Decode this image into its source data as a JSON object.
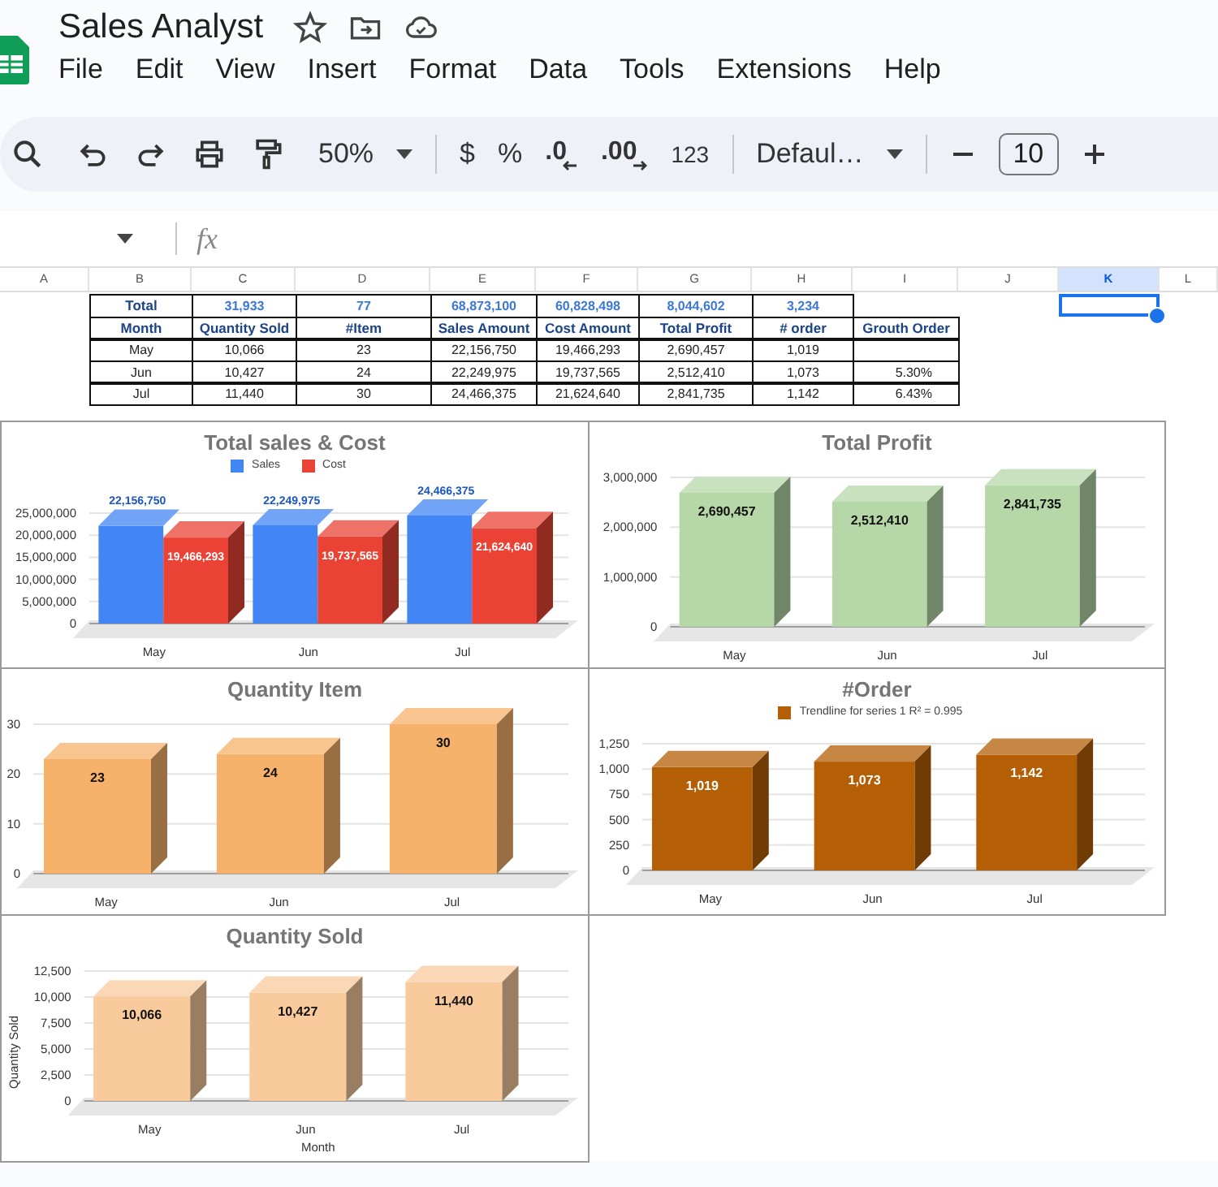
{
  "document": {
    "title": "Sales Analyst"
  },
  "menu": [
    "File",
    "Edit",
    "View",
    "Insert",
    "Format",
    "Data",
    "Tools",
    "Extensions",
    "Help"
  ],
  "toolbar": {
    "zoom": "50%",
    "currency": "$",
    "percent": "%",
    "decimals_less": ".0",
    "decimals_more": ".00",
    "number_format": "123",
    "font": "Defaul…",
    "font_size": "10"
  },
  "formula_bar": {
    "label": "fx"
  },
  "sheet": {
    "columns": [
      {
        "label": "A",
        "selected": false
      },
      {
        "label": "B",
        "selected": false
      },
      {
        "label": "C",
        "selected": false
      },
      {
        "label": "D",
        "selected": false
      },
      {
        "label": "E",
        "selected": false
      },
      {
        "label": "F",
        "selected": false
      },
      {
        "label": "G",
        "selected": false
      },
      {
        "label": "H",
        "selected": false
      },
      {
        "label": "I",
        "selected": false
      },
      {
        "label": "J",
        "selected": false
      },
      {
        "label": "K",
        "selected": true
      },
      {
        "label": "L",
        "selected": false
      }
    ],
    "rows": [
      {
        "kind": "total",
        "cells": [
          "",
          "Total",
          "31,933",
          "77",
          "68,873,100",
          "60,828,498",
          "8,044,602",
          "3,234"
        ]
      },
      {
        "kind": "header",
        "cells": [
          "",
          "Month",
          "Quantity  Sold",
          "#Item",
          "Sales Amount",
          "Cost Amount",
          "Total Profit",
          "# order",
          "Grouth Order"
        ]
      },
      {
        "kind": "data",
        "cells": [
          "",
          "May",
          "10,066",
          "23",
          "22,156,750",
          "19,466,293",
          "2,690,457",
          "1,019",
          ""
        ]
      },
      {
        "kind": "data",
        "cells": [
          "",
          "Jun",
          "10,427",
          "24",
          "22,249,975",
          "19,737,565",
          "2,512,410",
          "1,073",
          "5.30%"
        ]
      },
      {
        "kind": "data",
        "cells": [
          "",
          "Jul",
          "11,440",
          "30",
          "24,466,375",
          "21,624,640",
          "2,841,735",
          "1,142",
          "6.43%"
        ]
      }
    ]
  },
  "charts": [
    {
      "show_legend": true,
      "chart_data": {
        "type": "bar",
        "title": "Total sales & Cost",
        "categories": [
          "May",
          "Jun",
          "Jul"
        ],
        "series": [
          {
            "name": "Sales",
            "color": "#4285f4",
            "values": [
              22156750,
              22249975,
              24466375
            ],
            "value_labels": [
              "22,156,750",
              "22,249,975",
              "24,466,375"
            ]
          },
          {
            "name": "Cost",
            "color": "#ea4335",
            "values": [
              19466293,
              19737565,
              21624640
            ],
            "value_labels": [
              "19,466,293",
              "19,737,565",
              "21,624,640"
            ]
          }
        ],
        "ylim": [
          0,
          25000000
        ],
        "yticks": [
          {
            "value": 0,
            "label": "0"
          },
          {
            "value": 5000000,
            "label": "5,000,000"
          },
          {
            "value": 10000000,
            "label": "10,000,000"
          },
          {
            "value": 15000000,
            "label": "15,000,000"
          },
          {
            "value": 20000000,
            "label": "20,000,000"
          },
          {
            "value": 25000000,
            "label": "25,000,000"
          }
        ],
        "grid": true
      }
    },
    {
      "show_legend": false,
      "chart_data": {
        "type": "bar",
        "title": "Total Profit",
        "categories": [
          "May",
          "Jun",
          "Jul"
        ],
        "series": [
          {
            "color": "#b6d7a8",
            "values": [
              2690457,
              2512410,
              2841735
            ],
            "value_labels": [
              "2,690,457",
              "2,512,410",
              "2,841,735"
            ]
          }
        ],
        "ylim": [
          0,
          3000000
        ],
        "yticks": [
          {
            "value": 0,
            "label": "0"
          },
          {
            "value": 1000000,
            "label": "1,000,000"
          },
          {
            "value": 2000000,
            "label": "2,000,000"
          },
          {
            "value": 3000000,
            "label": "3,000,000"
          }
        ],
        "grid": true
      }
    },
    {
      "show_legend": false,
      "chart_data": {
        "type": "bar",
        "title": "Quantity Item",
        "categories": [
          "May",
          "Jun",
          "Jul"
        ],
        "series": [
          {
            "color": "#f6b26b",
            "values": [
              23,
              24,
              30
            ],
            "value_labels": [
              "23",
              "24",
              "30"
            ]
          }
        ],
        "ylim": [
          0,
          30
        ],
        "yticks": [
          {
            "value": 0,
            "label": "0"
          },
          {
            "value": 10,
            "label": "10"
          },
          {
            "value": 20,
            "label": "20"
          },
          {
            "value": 30,
            "label": "30"
          }
        ],
        "grid": true
      }
    },
    {
      "show_legend": true,
      "chart_data": {
        "type": "bar",
        "title": "#Order",
        "categories": [
          "May",
          "Jun",
          "Jul"
        ],
        "series": [
          {
            "name": "Trendline for series 1 R² = 0.995",
            "color": "#b45f06",
            "values": [
              1019,
              1073,
              1142
            ],
            "value_labels": [
              "1,019",
              "1,073",
              "1,142"
            ]
          }
        ],
        "ylim": [
          0,
          1250
        ],
        "yticks": [
          {
            "value": 0,
            "label": "0"
          },
          {
            "value": 250,
            "label": "250"
          },
          {
            "value": 500,
            "label": "500"
          },
          {
            "value": 750,
            "label": "750"
          },
          {
            "value": 1000,
            "label": "1,000"
          },
          {
            "value": 1250,
            "label": "1,250"
          }
        ],
        "grid": true
      }
    },
    {
      "show_legend": false,
      "chart_data": {
        "type": "bar",
        "title": "Quantity Sold",
        "xlabel": "Month",
        "ylabel": "Quantity Sold",
        "categories": [
          "May",
          "Jun",
          "Jul"
        ],
        "series": [
          {
            "color": "#f9cb9c",
            "values": [
              10066,
              10427,
              11440
            ],
            "value_labels": [
              "10,066",
              "10,427",
              "11,440"
            ]
          }
        ],
        "ylim": [
          0,
          12500
        ],
        "yticks": [
          {
            "value": 0,
            "label": "0"
          },
          {
            "value": 2500,
            "label": "2,500"
          },
          {
            "value": 5000,
            "label": "5,000"
          },
          {
            "value": 7500,
            "label": "7,500"
          },
          {
            "value": 10000,
            "label": "10,000"
          },
          {
            "value": 12500,
            "label": "12,500"
          }
        ],
        "grid": true
      }
    }
  ]
}
